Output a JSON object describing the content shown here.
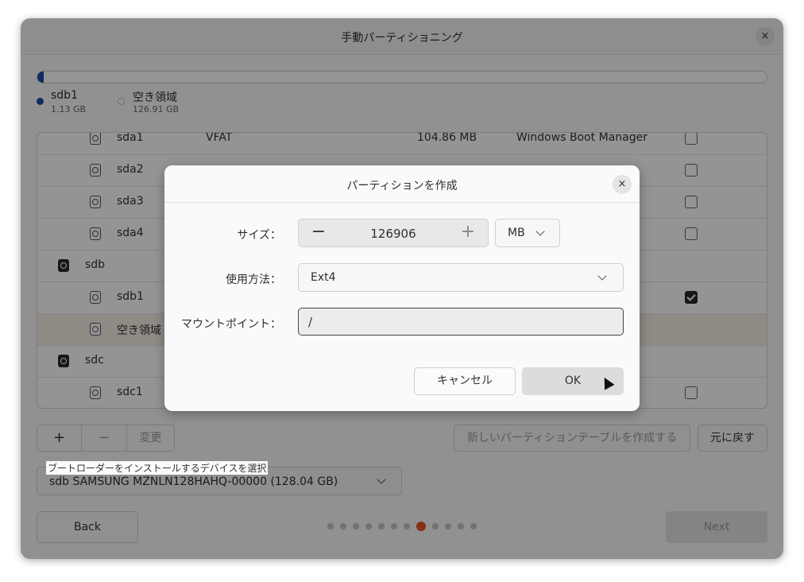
{
  "window": {
    "title": "手動パーティショニング",
    "close_icon": "×"
  },
  "usage_legend": [
    {
      "name": "sdb1",
      "size": "1.13 GB",
      "color": "#1a4aa8"
    },
    {
      "name": "空き領域",
      "size": "126.91 GB",
      "color": "#ffffff"
    }
  ],
  "usage_fraction": 0.009,
  "partitions": [
    {
      "device": "sda1",
      "type": "VFAT",
      "size": "104.86 MB",
      "system": "Windows Boot Manager",
      "checkbox": "unchecked"
    },
    {
      "device": "sda2",
      "checkbox": "unchecked"
    },
    {
      "device": "sda3",
      "checkbox": "unchecked"
    },
    {
      "device": "sda4",
      "checkbox": "unchecked"
    },
    {
      "device": "sdb",
      "disk": true
    },
    {
      "device": "sdb1",
      "checkbox": "checked"
    },
    {
      "device": "空き領域",
      "selected": true
    },
    {
      "device": "sdc",
      "disk": true
    },
    {
      "device": "sdc1",
      "checkbox": "unchecked"
    }
  ],
  "toolbar": {
    "add": "+",
    "remove": "−",
    "change": "変更"
  },
  "new_table_button": "新しいパーティションテーブルを作成する",
  "revert_button": "元に戻す",
  "bootloader": {
    "label": "ブートローダーをインストールするデバイスを選択",
    "value": "sdb SAMSUNG MZNLN128HAHQ-00000 (128.04 GB)"
  },
  "nav": {
    "back": "Back",
    "next": "Next",
    "step_count": 12,
    "active_step": 7
  },
  "dialog": {
    "title": "パーティションを作成",
    "size_label": "サイズ：",
    "size_value": "126906",
    "minus": "−",
    "plus": "+",
    "unit": "MB",
    "use_label": "使用方法：",
    "use_value": "Ext4",
    "mount_label": "マウントポイント：",
    "mount_value": "/",
    "cancel": "キャンセル",
    "ok": "OK"
  }
}
